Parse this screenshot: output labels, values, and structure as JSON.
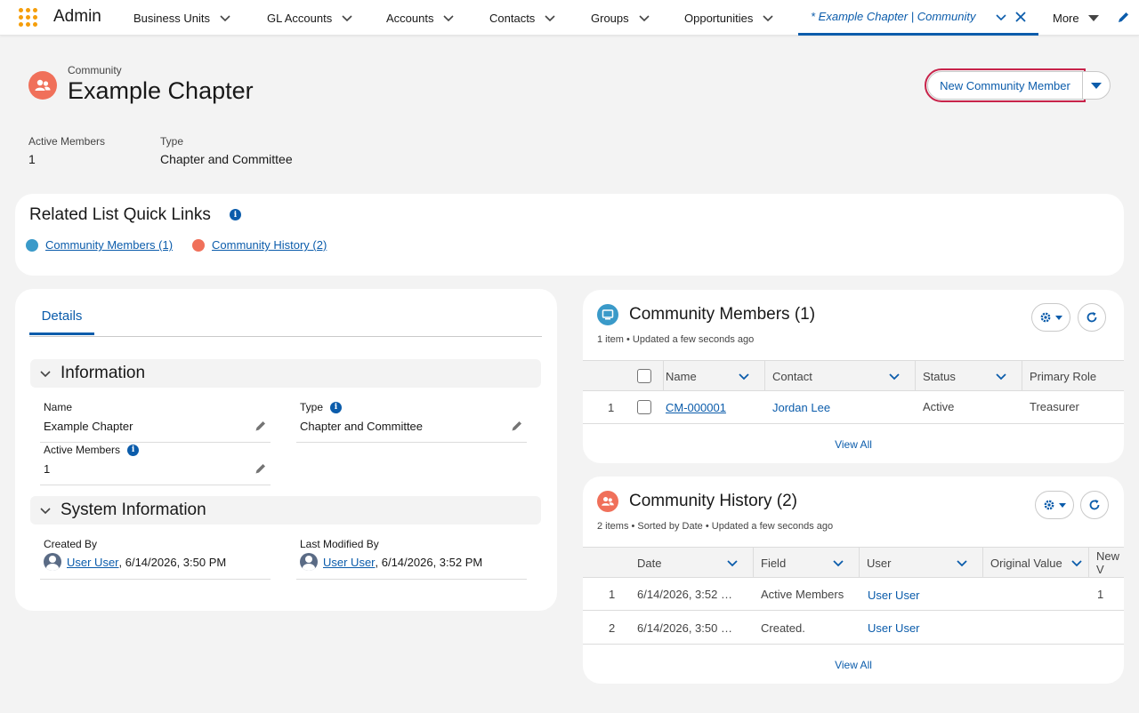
{
  "nav": {
    "app_name": "Admin",
    "tabs": [
      "Business Units",
      "GL Accounts",
      "Accounts",
      "Contacts",
      "Groups",
      "Opportunities"
    ],
    "active_tab": "* Example Chapter | Community",
    "more": "More"
  },
  "header": {
    "object_label": "Community",
    "title": "Example Chapter",
    "new_member_button": "New Community Member",
    "highlights": [
      {
        "label": "Active Members",
        "value": "1"
      },
      {
        "label": "Type",
        "value": "Chapter and Committee"
      }
    ]
  },
  "quick_links": {
    "title": "Related List Quick Links",
    "links": [
      "Community Members (1)",
      "Community History (2)"
    ]
  },
  "details": {
    "tab": "Details",
    "info_section": "Information",
    "fields": {
      "name_label": "Name",
      "name_value": "Example Chapter",
      "type_label": "Type",
      "type_value": "Chapter and Committee",
      "active_label": "Active Members",
      "active_value": "1"
    },
    "system_section": "System Information",
    "created_by_label": "Created By",
    "created_by_user": "User User",
    "created_by_date": ", 6/14/2026, 3:50 PM",
    "modified_by_label": "Last Modified By",
    "modified_by_user": "User User",
    "modified_by_date": ", 6/14/2026, 3:52 PM"
  },
  "members": {
    "title": "Community Members (1)",
    "subtitle": "1 item • Updated a few seconds ago",
    "columns": [
      "Name",
      "Contact",
      "Status",
      "Primary Role"
    ],
    "rows": [
      {
        "num": "1",
        "name": "CM-000001",
        "contact": "Jordan Lee",
        "status": "Active",
        "role": "Treasurer"
      }
    ],
    "view_all": "View All"
  },
  "history": {
    "title": "Community History (2)",
    "subtitle": "2 items • Sorted by Date • Updated a few seconds ago",
    "columns": [
      "Date",
      "Field",
      "User",
      "Original Value",
      "New V"
    ],
    "rows": [
      {
        "num": "1",
        "date": "6/14/2026, 3:52 …",
        "field": "Active Members",
        "user": "User User",
        "new": "1"
      },
      {
        "num": "2",
        "date": "6/14/2026, 3:50 …",
        "field": "Created.",
        "user": "User User",
        "new": ""
      }
    ],
    "view_all": "View All"
  },
  "colors": {
    "brand": "#0b5cab",
    "accent_red": "#c8234a",
    "community_icon": "#f0705a",
    "members_icon": "#3a9ac9"
  }
}
